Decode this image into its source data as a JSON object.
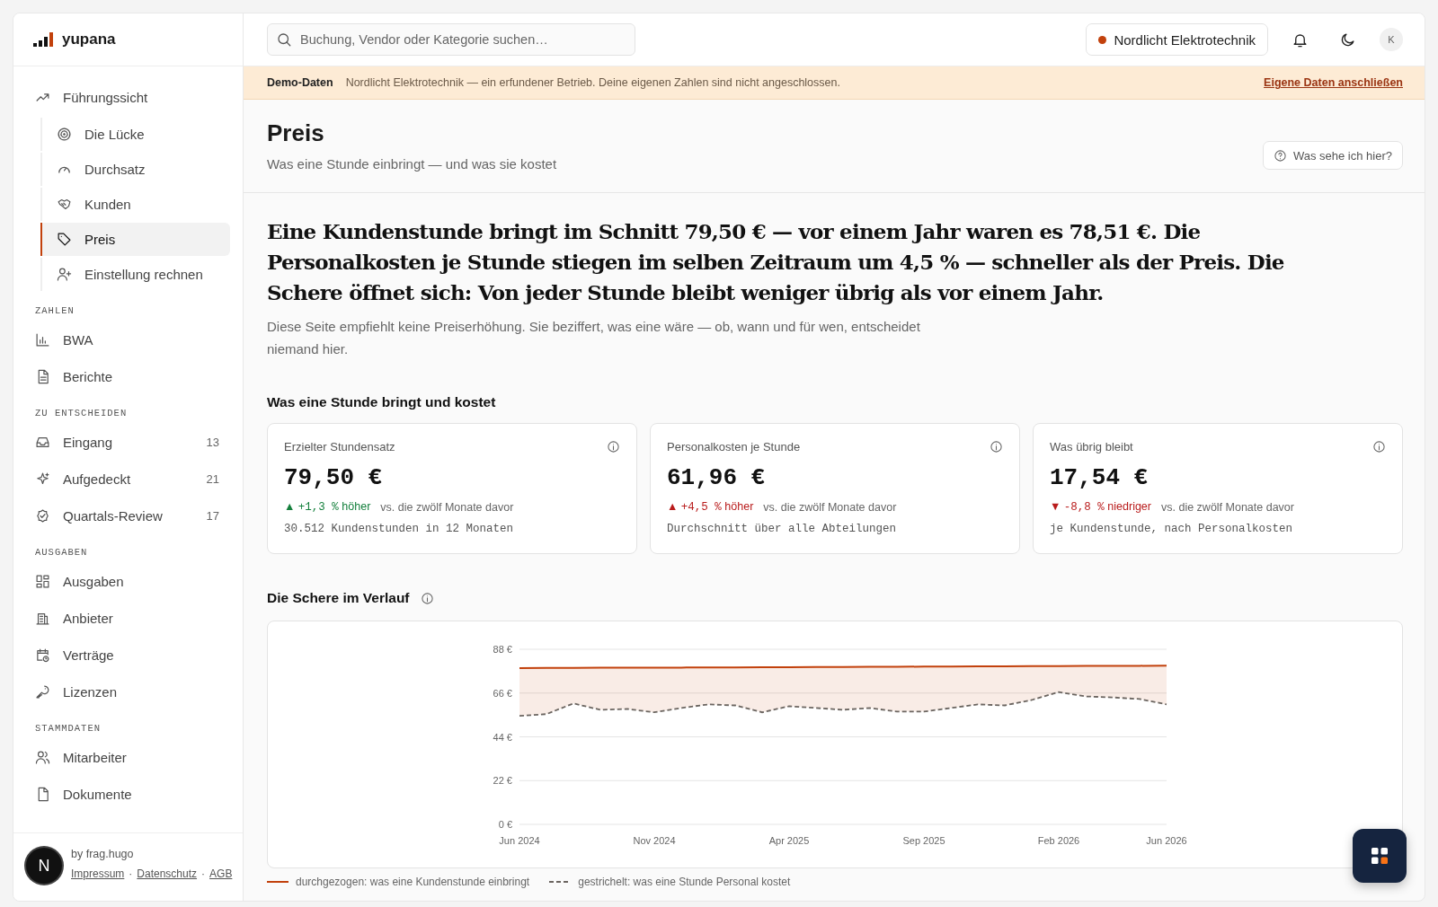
{
  "brand": {
    "name": "yupana"
  },
  "sidebar": {
    "items": [
      {
        "label": "Führungssicht",
        "children": [
          {
            "label": "Die Lücke",
            "selected": false
          },
          {
            "label": "Durchsatz",
            "selected": false
          },
          {
            "label": "Kunden",
            "selected": false
          },
          {
            "label": "Preis",
            "selected": true
          },
          {
            "label": "Einstellung rechnen",
            "selected": false
          }
        ]
      }
    ],
    "sections": [
      {
        "heading": "ZAHLEN",
        "items": [
          {
            "label": "BWA"
          },
          {
            "label": "Berichte"
          }
        ]
      },
      {
        "heading": "ZU ENTSCHEIDEN",
        "items": [
          {
            "label": "Eingang",
            "count": "13"
          },
          {
            "label": "Aufgedeckt",
            "count": "21"
          },
          {
            "label": "Quartals-Review",
            "count": "17"
          }
        ]
      },
      {
        "heading": "AUSGABEN",
        "items": [
          {
            "label": "Ausgaben"
          },
          {
            "label": "Anbieter"
          },
          {
            "label": "Verträge"
          },
          {
            "label": "Lizenzen"
          }
        ]
      },
      {
        "heading": "STAMMDATEN",
        "items": [
          {
            "label": "Mitarbeiter"
          },
          {
            "label": "Dokumente"
          }
        ]
      }
    ],
    "footer": {
      "credit": "by frag.hugo",
      "links": [
        {
          "kind": "link",
          "text": "Impressum"
        },
        {
          "kind": "separator",
          "text": "·"
        },
        {
          "kind": "link",
          "text": "Datenschutz"
        },
        {
          "kind": "separator",
          "text": "·"
        },
        {
          "kind": "link",
          "text": "AGB"
        }
      ]
    }
  },
  "topbar": {
    "search": {
      "placeholder": "Buchung, Vendor oder Kategorie suchen…"
    },
    "company": {
      "name": "Nordlicht Elektrotechnik",
      "color": "#c2410c"
    },
    "avatar": "K"
  },
  "banner": {
    "label": "Demo-Daten",
    "text": "Nordlicht Elektrotechnik — ein erfundener Betrieb. Deine eigenen Zahlen sind nicht angeschlossen.",
    "link": "Eigene Daten anschließen"
  },
  "header": {
    "title": "Preis",
    "subtitle": "Was eine Stunde einbringt — und was sie kostet",
    "help": "Was sehe ich hier?"
  },
  "headline": "Eine Kundenstunde bringt im Schnitt 79,50 € — vor einem Jahr waren es 78,51 €. Die Personalkosten je Stunde stiegen im selben Zeitraum um 4,5 % — schneller als der Preis. Die Schere öffnet sich: Von jeder Stunde bleibt weniger übrig als vor einem Jahr.",
  "note": "Diese Seite empfiehlt keine Preiserhöhung. Sie beziffert, was eine wäre — ob, wann und für wen, entscheidet niemand hier.",
  "metrics": {
    "title": "Was eine Stunde bringt und kostet",
    "cards": [
      {
        "label": "Erzielter Stundensatz",
        "value": "79,50 €",
        "arrow": "▲",
        "color": "#15803d",
        "delta": "+1,3 %",
        "word": "höher",
        "comparison": "vs. die zwölf Monate davor",
        "detail": "30.512 Kundenstunden in 12 Monaten"
      },
      {
        "label": "Personalkosten je Stunde",
        "value": "61,96 €",
        "arrow": "▲",
        "color": "#b91c1c",
        "delta": "+4,5 %",
        "word": "höher",
        "comparison": "vs. die zwölf Monate davor",
        "detail": "Durchschnitt über alle Abteilungen"
      },
      {
        "label": "Was übrig bleibt",
        "value": "17,54 €",
        "arrow": "▼",
        "color": "#b91c1c",
        "delta": "-8,8 %",
        "word": "niedriger",
        "comparison": "vs. die zwölf Monate davor",
        "detail": "je Kundenstunde, nach Personalkosten"
      }
    ]
  },
  "chart": {
    "title": "Die Schere im Verlauf",
    "chart_data": {
      "type": "line",
      "grid": true,
      "categories": [
        "Jun 2024",
        null,
        null,
        null,
        null,
        "Nov 2024",
        null,
        null,
        null,
        null,
        "Apr 2025",
        null,
        null,
        null,
        null,
        "Sep 2025",
        null,
        null,
        null,
        null,
        "Feb 2026",
        null,
        null,
        null,
        "Jun 2026"
      ],
      "yticks": [
        {
          "value": 0,
          "label": "0 €"
        },
        {
          "value": 22,
          "label": "22 €"
        },
        {
          "value": 44,
          "label": "44 €"
        },
        {
          "value": 66,
          "label": "66 €"
        },
        {
          "value": 88,
          "label": "88 €"
        }
      ],
      "ylim": [
        0,
        88
      ],
      "series": [
        {
          "name": "durchgezogen: was eine Kundenstunde einbringt",
          "color": "#c2410c",
          "line_style": "solid",
          "values": [
            78.5,
            78.6,
            78.6,
            78.7,
            78.7,
            78.8,
            78.8,
            78.9,
            78.9,
            79.0,
            79.0,
            79.1,
            79.1,
            79.2,
            79.2,
            79.3,
            79.3,
            79.4,
            79.4,
            79.5,
            79.5,
            79.6,
            79.6,
            79.7,
            79.8
          ]
        },
        {
          "name": "gestrichelt: was eine Stunde Personal kostet",
          "color": "#6b6560",
          "line_style": "dashed",
          "values": [
            54.5,
            55.4,
            60.8,
            57.6,
            58.0,
            56.3,
            58.5,
            60.3,
            59.8,
            56.3,
            59.4,
            58.5,
            57.6,
            58.5,
            56.7,
            56.7,
            58.5,
            60.3,
            59.8,
            62.5,
            66.5,
            64.3,
            63.8,
            63.0,
            60.3
          ]
        }
      ]
    }
  },
  "fab": "N"
}
